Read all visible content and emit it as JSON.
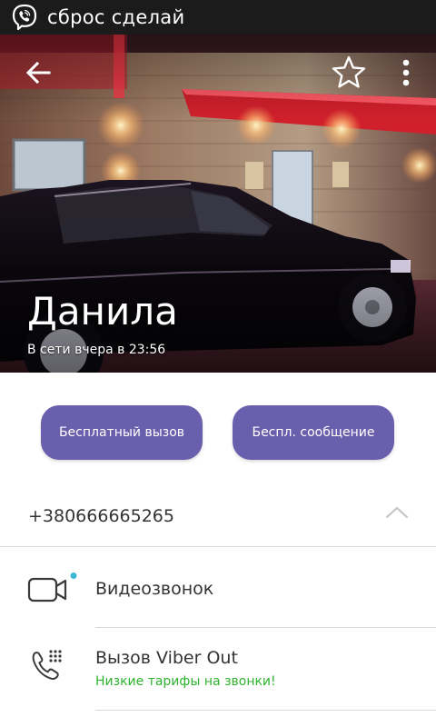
{
  "status_bar": {
    "app_icon": "viber-logo-icon",
    "text": "сброс сделай"
  },
  "header": {
    "back_icon": "arrow-left-icon",
    "favorite_icon": "star-outline-icon",
    "more_icon": "more-vertical-icon",
    "contact_name": "Данила",
    "last_seen": "В сети вчера в 23:56"
  },
  "actions": {
    "free_call": "Бесплатный вызов",
    "free_message": "Беспл. сообщение",
    "accent_color": "#6a5fad"
  },
  "phone": {
    "number": "+380666665265",
    "collapse_icon": "chevron-up-icon"
  },
  "options": {
    "video_call": {
      "icon": "video-camera-icon",
      "label": "Видеозвонок"
    },
    "viber_out": {
      "icon": "phone-dialpad-icon",
      "label": "Вызов Viber Out",
      "sublabel": "Низкие тарифы на звонки!",
      "sublabel_color": "#2fb32f"
    }
  }
}
